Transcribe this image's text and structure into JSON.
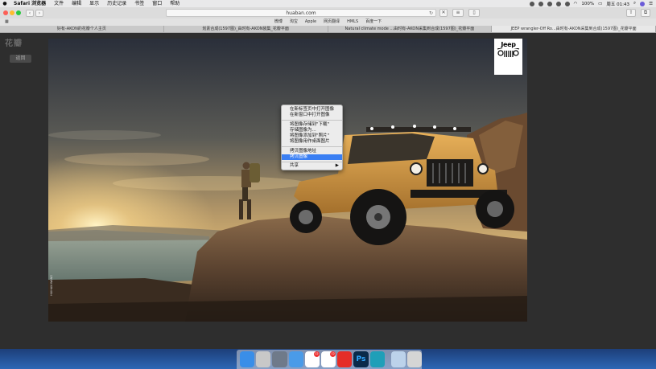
{
  "menubar": {
    "app": "Safari 浏览器",
    "items": [
      "文件",
      "编辑",
      "显示",
      "历史记录",
      "书签",
      "窗口",
      "帮助"
    ],
    "battery": "100%",
    "clock": "周五 01:43"
  },
  "toolbar": {
    "url": "huaban.com"
  },
  "favorites": [
    "微博",
    "淘宝",
    "Apple",
    "网页翻译",
    "HMLS",
    "百度一下"
  ],
  "tabs": [
    {
      "label": "好有-AKON的花瓣个人主页",
      "active": false
    },
    {
      "label": "划素合成(1597图)_由时有-AKON装集_花瓣平面",
      "active": false
    },
    {
      "label": "Natural climate mode ...由时有-AKON采集到合成(1597图)_花瓣平面",
      "active": false
    },
    {
      "label": "JEEP wrangler-Off Ro...由时有-AKON采集到合成(1597图)_花瓣平面",
      "active": true
    }
  ],
  "page": {
    "logo": "花瓣",
    "back_label": "返回",
    "brand_badge": "Jeep",
    "watermark": "HUIHAN WANG"
  },
  "context_menu": {
    "groups": [
      [
        "在新标签页中打开图像",
        "在新窗口中打开图像"
      ],
      [
        "将图像存储到\"下载\"",
        "存储图像为...",
        "将图像添加到\"照片\"",
        "将图像用作桌面图片"
      ],
      [
        "拷贝图像地址",
        "拷贝图像"
      ],
      [
        "共享"
      ]
    ],
    "highlighted": "拷贝图像",
    "submenu_item": "共享",
    "submenu_arrow": "▶"
  },
  "dock": {
    "badges": [
      "12",
      "12"
    ]
  },
  "colors": {
    "menu_highlight": "#3a7ff3",
    "page_bg": "#2e2e2e"
  }
}
